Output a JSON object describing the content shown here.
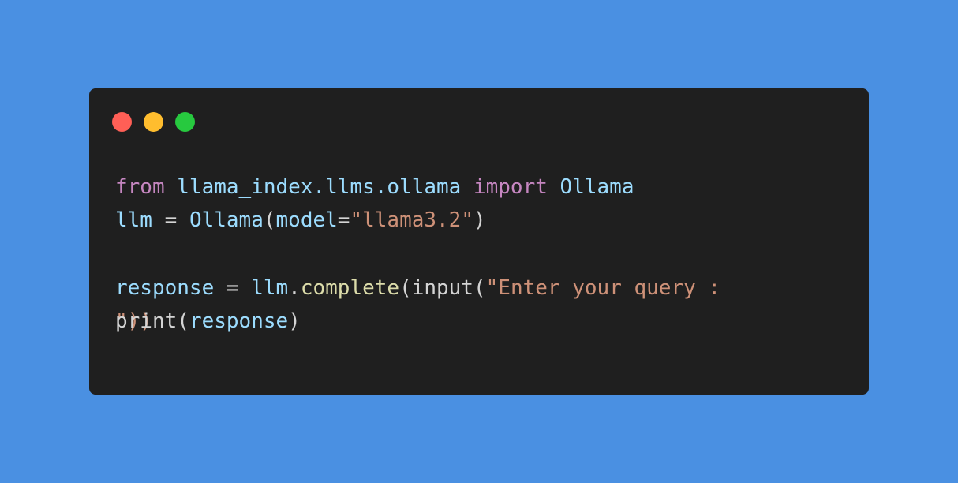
{
  "window": {
    "controls": [
      "close",
      "minimize",
      "maximize"
    ],
    "background": "#1f1f1f",
    "page_background": "#4a90e2"
  },
  "code": {
    "line1": {
      "from": "from",
      "module": "llama_index.llms.ollama",
      "import": "import",
      "name": "Ollama"
    },
    "line2": {
      "var": "llm",
      "eq": " = ",
      "cls": "Ollama",
      "open": "(",
      "param": "model",
      "assign": "=",
      "value": "\"llama3.2\"",
      "close": ")"
    },
    "line3": {
      "var": "response",
      "eq": " = ",
      "obj": "llm",
      "dot": ".",
      "method": "complete",
      "open": "(",
      "builtin": "input",
      "open2": "(",
      "value": "\"Enter your query :"
    },
    "line4": {
      "value": "\"))"
    },
    "line5": {
      "builtin": "print",
      "open": "(",
      "arg": "response",
      "close": ")"
    }
  }
}
